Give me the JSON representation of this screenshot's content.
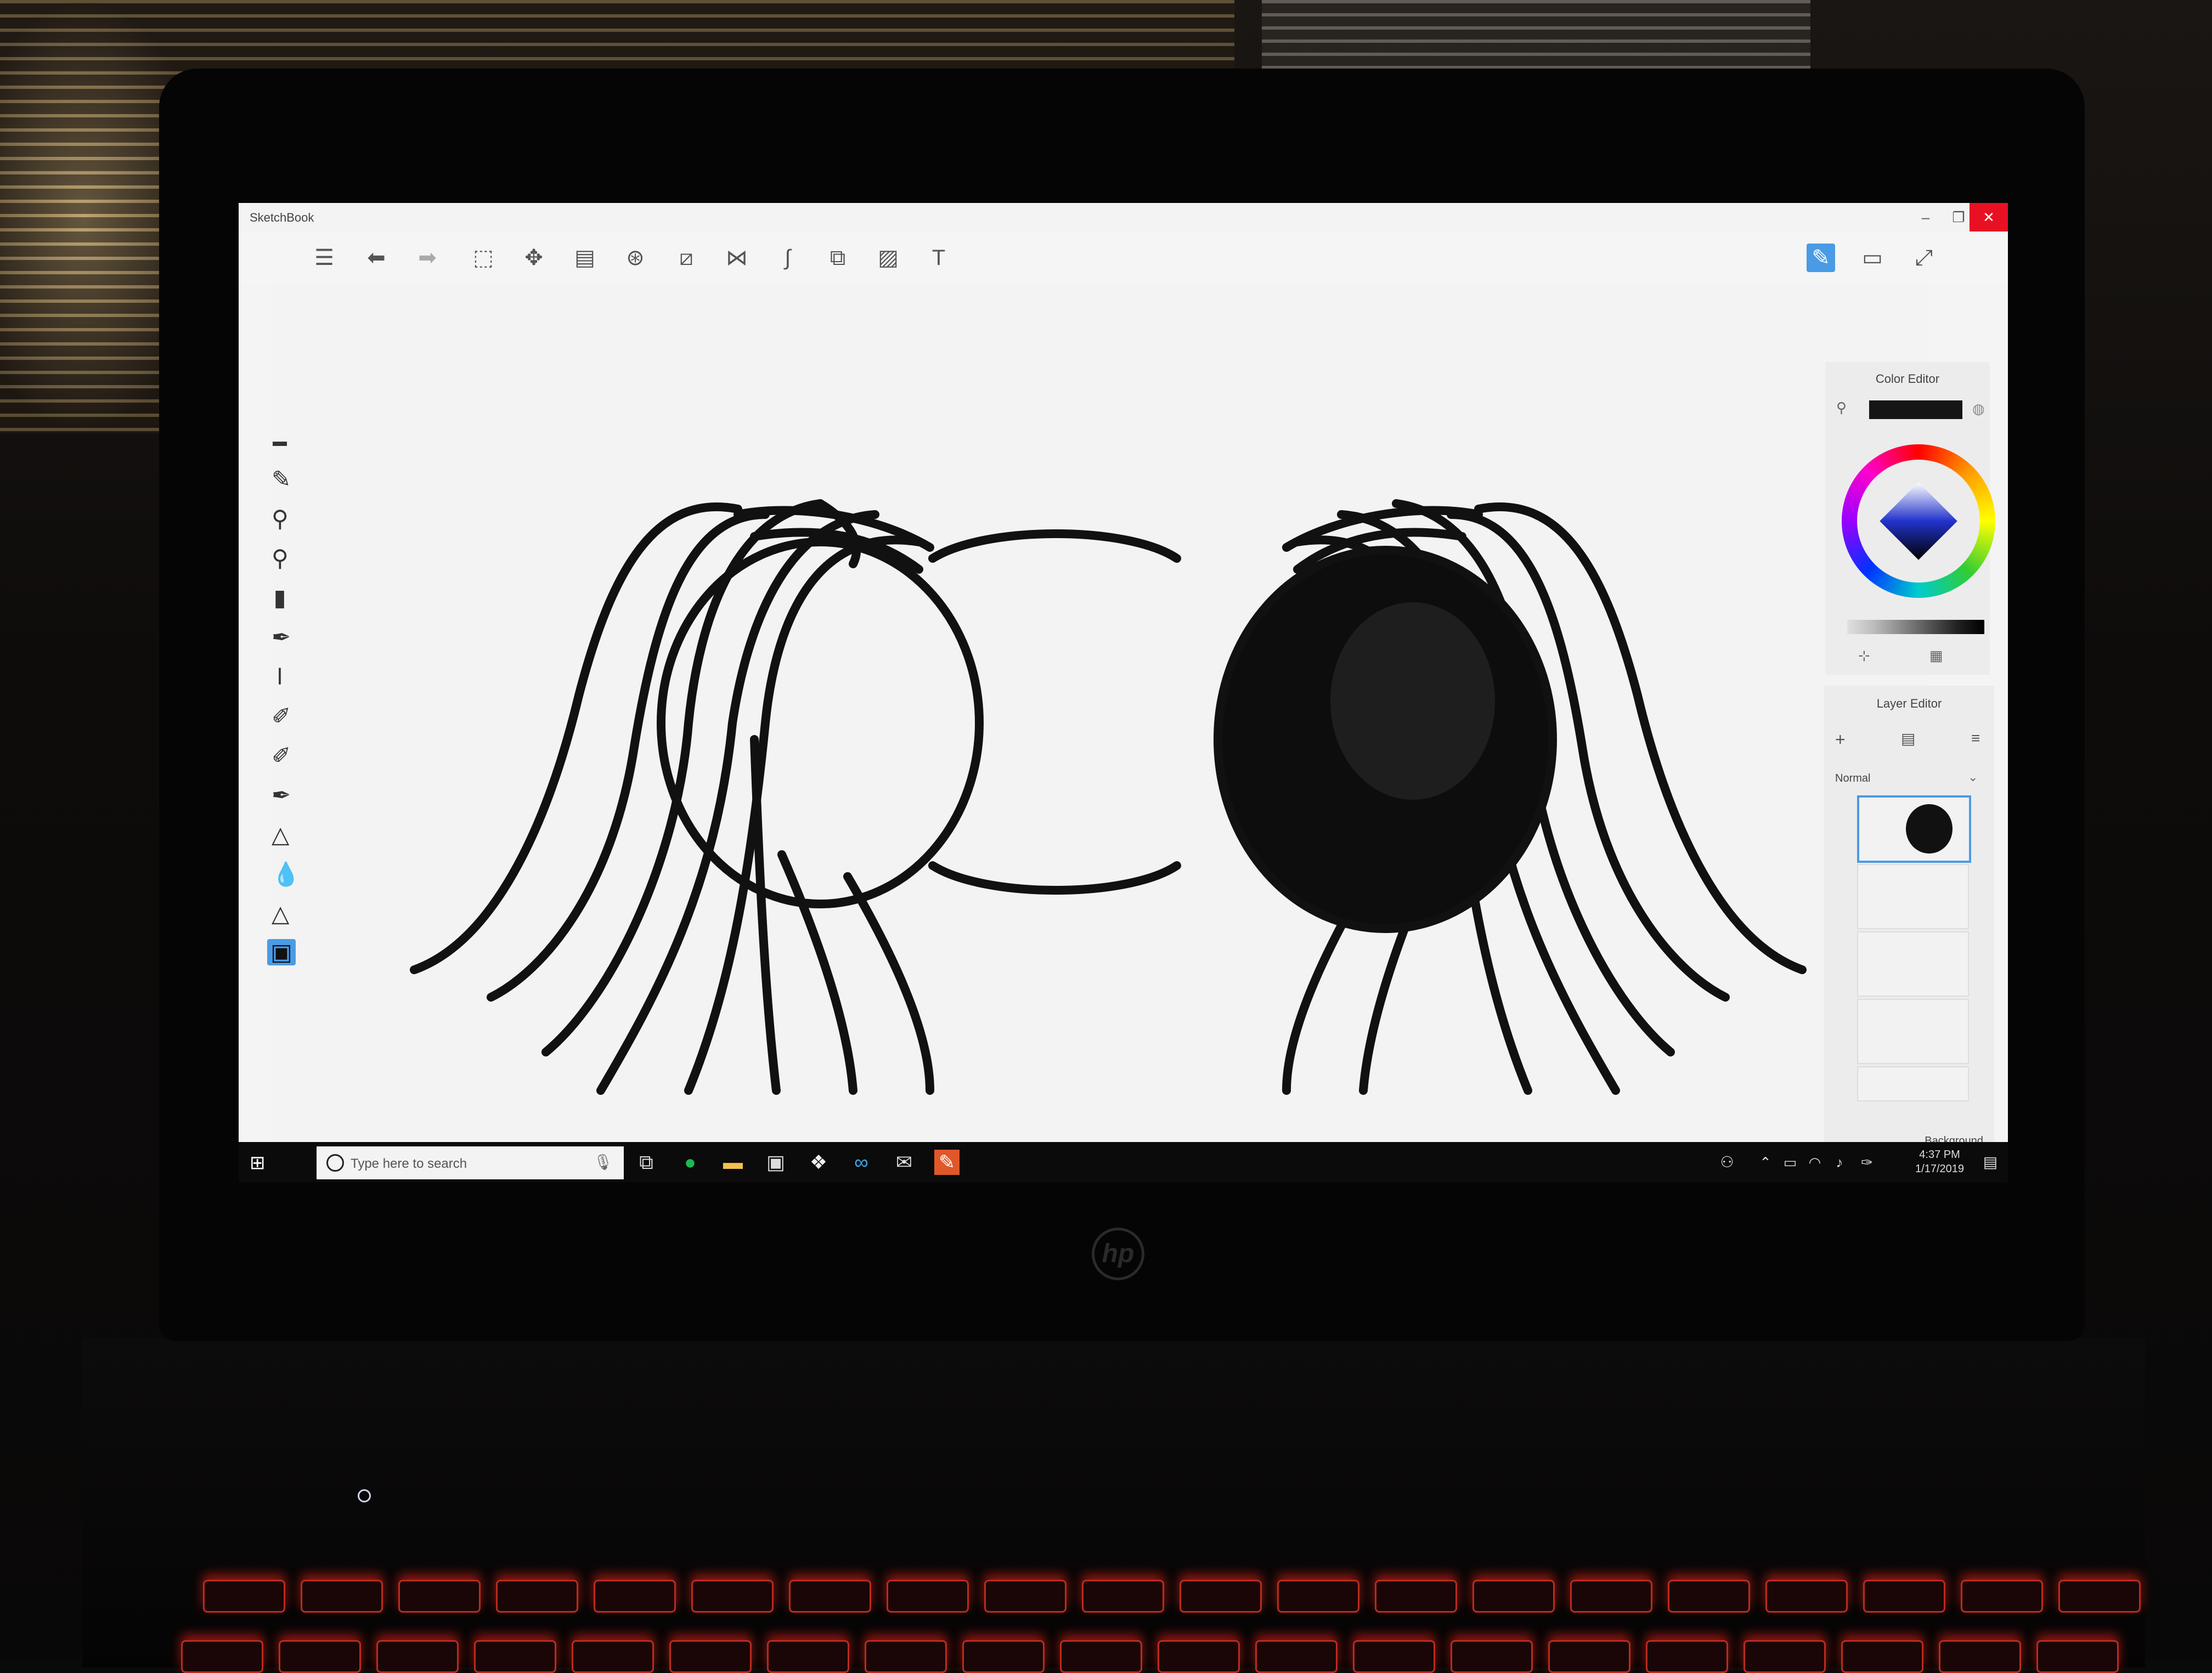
{
  "colors": {
    "accent": "#4a9be5",
    "close_button": "#e81123",
    "ink": "#111111",
    "keyboard_backlight": "#ff3b2a"
  },
  "app": {
    "title": "SketchBook",
    "window_controls": {
      "minimize": "–",
      "restore": "❐",
      "close": "✕"
    }
  },
  "toolbar": {
    "icons": [
      "menu-list-icon",
      "undo-icon",
      "redo-icon",
      "select-icon",
      "transform-icon",
      "layer-copy-icon",
      "color-mixer-icon",
      "ruler-icon",
      "symmetry-icon",
      "curve-icon",
      "shape-icon",
      "image-import-icon",
      "text-icon"
    ],
    "right_icons": [
      "pencil-icon",
      "window-icon",
      "fullscreen-icon"
    ]
  },
  "brushes": {
    "icons": [
      "brush-1",
      "brush-2",
      "brush-3",
      "brush-4",
      "brush-5",
      "brush-6",
      "brush-7",
      "brush-8",
      "brush-9",
      "brush-10",
      "brush-11",
      "brush-12",
      "brush-13"
    ],
    "active_index": 12
  },
  "color_editor": {
    "title": "Color Editor",
    "current_color": "#151515"
  },
  "layer_editor": {
    "title": "Layer Editor",
    "blend_mode": "Normal",
    "background_label": "Background",
    "layer_count": 5,
    "selected_layer": 1
  },
  "taskbar": {
    "search_placeholder": "Type here to search",
    "time": "4:37 PM",
    "date": "1/17/2019"
  }
}
